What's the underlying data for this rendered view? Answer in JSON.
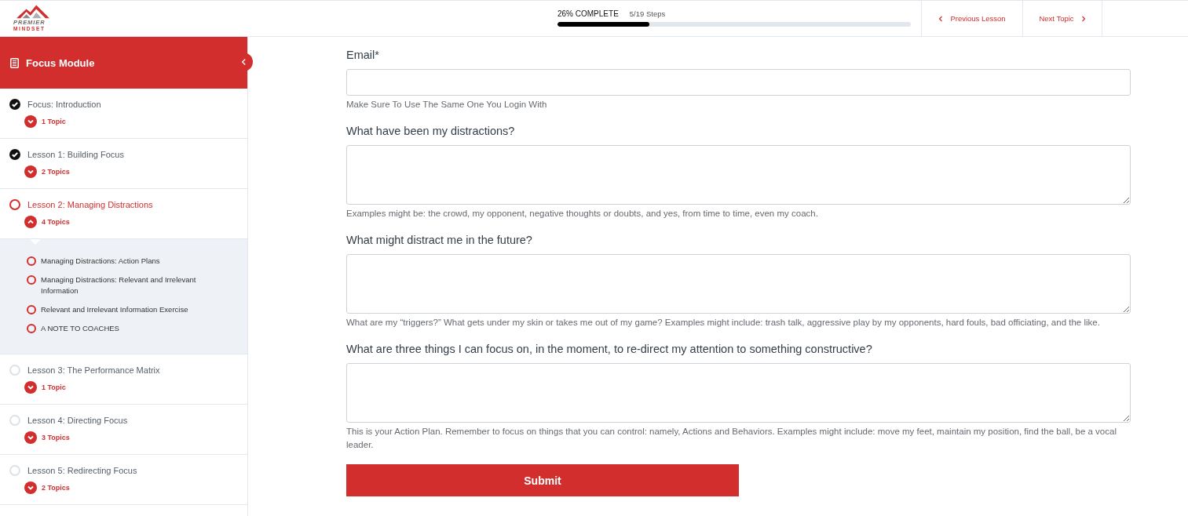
{
  "header": {
    "logo": {
      "line_1": "PREMIER",
      "line_2": "MINDSET"
    },
    "progress": {
      "percent_label": "26% COMPLETE",
      "steps_label": "5/19 Steps",
      "level": 0.26
    },
    "nav": [
      {
        "label": "Previous Lesson",
        "kind": "previous"
      },
      {
        "label": "Next Topic",
        "kind": "next"
      }
    ]
  },
  "sidebar": {
    "title": "Focus Module",
    "lessons": [
      {
        "title": "Focus: Introduction",
        "completed": true,
        "selected": false,
        "topics_label": "1 Topic",
        "expanded": false
      },
      {
        "title": "Lesson 1: Building Focus",
        "completed": true,
        "selected": false,
        "topics_label": "2 Topics",
        "expanded": false
      },
      {
        "title": "Lesson 2: Managing Distractions",
        "completed": false,
        "selected": true,
        "topics_label": "4 Topics",
        "expanded": true,
        "children": [
          {
            "title": "Managing Distractions: Action Plans",
            "completed": false
          },
          {
            "title": "Managing Distractions: Relevant and Irrelevant Information",
            "completed": false
          },
          {
            "title": "Relevant and Irrelevant Information Exercise",
            "completed": false
          },
          {
            "title": "A NOTE TO COACHES",
            "completed": false
          }
        ]
      },
      {
        "title": "Lesson 3: The Performance Matrix",
        "completed": false,
        "selected": false,
        "topics_label": "1 Topic",
        "expanded": false
      },
      {
        "title": "Lesson 4: Directing Focus",
        "completed": false,
        "selected": false,
        "topics_label": "3 Topics",
        "expanded": false
      },
      {
        "title": "Lesson 5: Redirecting Focus",
        "completed": false,
        "selected": false,
        "topics_label": "2 Topics",
        "expanded": false
      }
    ]
  },
  "form": {
    "fields": [
      {
        "label": "Email*",
        "kind": "input",
        "hint": "Make Sure To Use The Same One You Login With"
      },
      {
        "label": "What have been my distractions?",
        "kind": "textarea",
        "hint": "Examples might be: the crowd, my opponent, negative thoughts or doubts, and yes, from time to time, even my coach."
      },
      {
        "label": "What might distract me in the future?",
        "kind": "textarea",
        "hint": "What are my “triggers?” What gets under my skin or takes me out of my game? Examples might include: trash talk, aggressive play by my opponents, hard fouls, bad officiating, and the like."
      },
      {
        "label": "What are three things I can focus on, in the moment, to re-direct my attention to something constructive?",
        "kind": "textarea",
        "hint": "This is your Action Plan. Remember to focus on things that you can control: namely, Actions and Behaviors. Examples might include: move my feet, maintain my position, find the ball, be a vocal leader."
      }
    ],
    "submit": "Submit"
  }
}
